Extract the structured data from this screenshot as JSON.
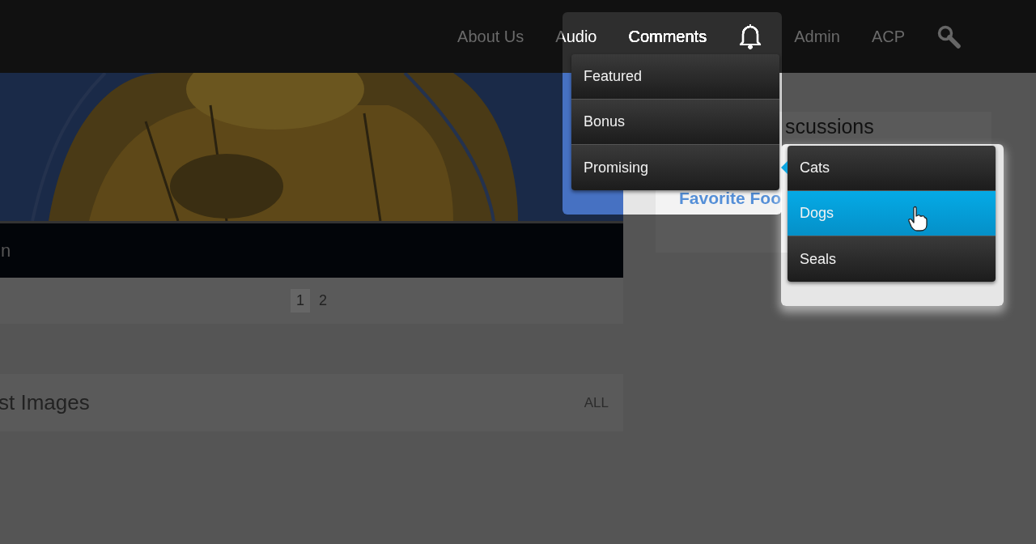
{
  "nav": [
    {
      "kind": "link",
      "label": "About Us",
      "selected": false
    },
    {
      "kind": "link",
      "label": "Audio",
      "selected": false
    },
    {
      "kind": "link",
      "label": "Comments",
      "selected": true
    },
    {
      "kind": "bell"
    },
    {
      "kind": "link",
      "label": "Admin",
      "selected": false
    },
    {
      "kind": "link",
      "label": "ACP",
      "selected": false
    },
    {
      "kind": "search"
    }
  ],
  "dropdown": [
    {
      "label": "Featured",
      "selected": false
    },
    {
      "label": "Bonus",
      "selected": false
    },
    {
      "label": "Promising",
      "selected": false
    }
  ],
  "submenu": [
    {
      "label": "Cats",
      "selected": false
    },
    {
      "label": "Dogs",
      "selected": true
    },
    {
      "label": "Seals",
      "selected": false
    }
  ],
  "banner": {
    "kind": "picture",
    "caption": "n"
  },
  "pagination": [
    {
      "label": "1",
      "selected": true
    },
    {
      "label": "2",
      "selected": false
    }
  ],
  "images_panel": {
    "title": "st Images",
    "all_link": "ALL"
  },
  "sidebar": {
    "title": "scussions",
    "items": [
      "Favorite Foo"
    ]
  }
}
